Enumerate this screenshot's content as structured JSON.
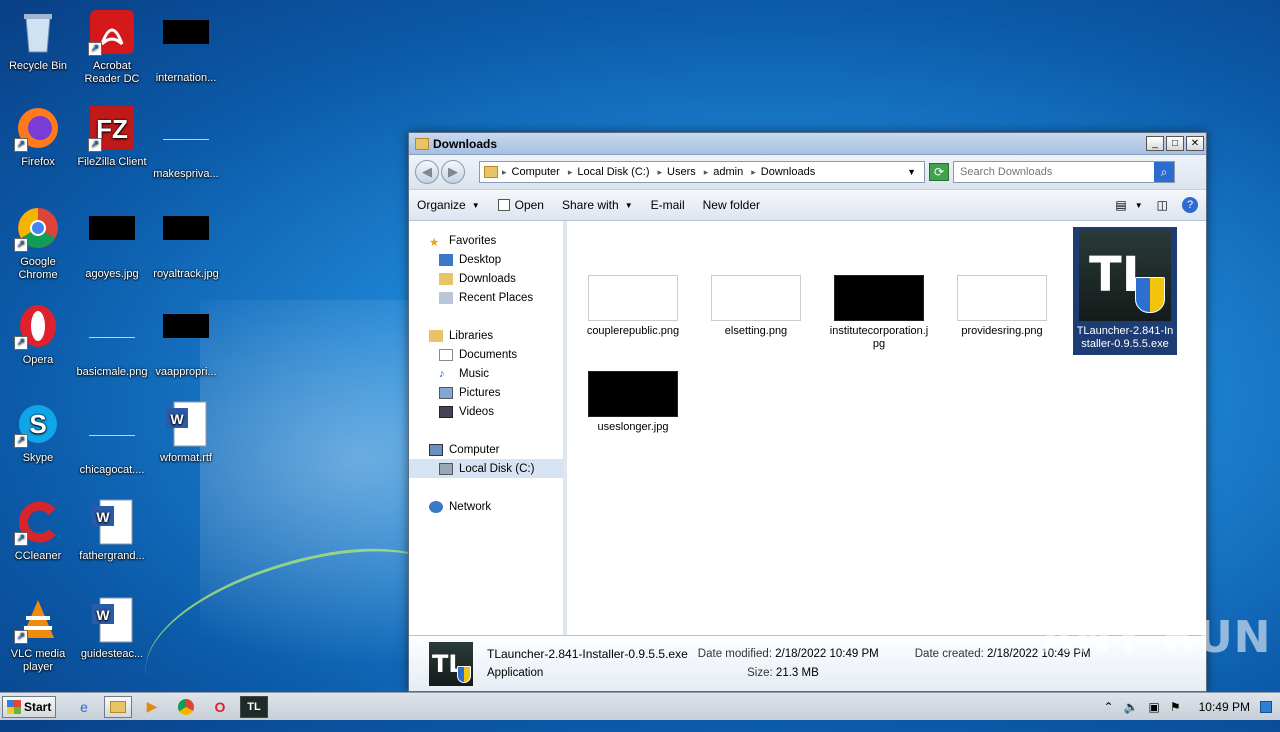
{
  "desktop": {
    "icons": [
      {
        "label": "Recycle Bin"
      },
      {
        "label": "Acrobat Reader DC"
      },
      {
        "label": "internation..."
      },
      {
        "label": "Firefox"
      },
      {
        "label": "FileZilla Client"
      },
      {
        "label": "makespriva..."
      },
      {
        "label": "Google Chrome"
      },
      {
        "label": "agoyes.jpg"
      },
      {
        "label": "royaltrack.jpg"
      },
      {
        "label": "Opera"
      },
      {
        "label": "basicmale.png"
      },
      {
        "label": "vaappropri..."
      },
      {
        "label": "Skype"
      },
      {
        "label": "chicagocat...."
      },
      {
        "label": "wformat.rtf"
      },
      {
        "label": "CCleaner"
      },
      {
        "label": "fathergrand..."
      },
      {
        "label": "VLC media player"
      },
      {
        "label": "guidesteac..."
      }
    ]
  },
  "window": {
    "title": "Downloads",
    "controls": {
      "minimize": "_",
      "maximize": "□",
      "close": "✕"
    },
    "address": {
      "crumbs": [
        "Computer",
        "Local Disk (C:)",
        "Users",
        "admin",
        "Downloads"
      ]
    },
    "search": {
      "placeholder": "Search Downloads"
    },
    "toolbar": {
      "organize": "Organize",
      "open": "Open",
      "share_with": "Share with",
      "email": "E-mail",
      "new_folder": "New folder"
    },
    "nav": {
      "favorites": "Favorites",
      "desktop": "Desktop",
      "downloads": "Downloads",
      "recent_places": "Recent Places",
      "libraries": "Libraries",
      "documents": "Documents",
      "music": "Music",
      "pictures": "Pictures",
      "videos": "Videos",
      "computer": "Computer",
      "local_disk": "Local Disk (C:)",
      "network": "Network"
    },
    "files": [
      {
        "name": "couplerepublic.png"
      },
      {
        "name": "elsetting.png"
      },
      {
        "name": "institutecorporation.jpg"
      },
      {
        "name": "providesring.png"
      },
      {
        "name": "TLauncher-2.841-Installer-0.9.5.5.exe"
      },
      {
        "name": "useslonger.jpg"
      }
    ],
    "details": {
      "file_name": "TLauncher-2.841-Installer-0.9.5.5.exe",
      "file_type": "Application",
      "date_modified_label": "Date modified:",
      "date_modified": "2/18/2022 10:49 PM",
      "size_label": "Size:",
      "size": "21.3 MB",
      "date_created_label": "Date created:",
      "date_created": "2/18/2022 10:49 PM"
    }
  },
  "taskbar": {
    "start_label": "Start",
    "clock": "10:49 PM"
  },
  "watermark": "ANY RUN"
}
